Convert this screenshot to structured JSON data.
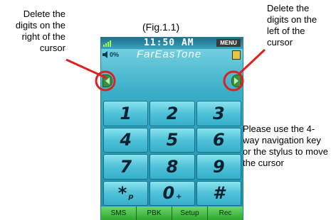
{
  "figure": {
    "caption": "(Fig.1.1)"
  },
  "annotations": {
    "left": "Delete the digits on the right of the cursor",
    "right": "Delete the digits on the left of the cursor",
    "bottom": "Please use the 4-way navigation key or the stylus to move the cursor"
  },
  "phone": {
    "status": {
      "time": "11:50 AM",
      "menu_label": "MENU",
      "volume_level": "0%"
    },
    "carrier": "FarEasTone",
    "keys": [
      {
        "label": "1",
        "sub": ""
      },
      {
        "label": "2",
        "sub": ""
      },
      {
        "label": "3",
        "sub": ""
      },
      {
        "label": "4",
        "sub": ""
      },
      {
        "label": "5",
        "sub": ""
      },
      {
        "label": "6",
        "sub": ""
      },
      {
        "label": "7",
        "sub": ""
      },
      {
        "label": "8",
        "sub": ""
      },
      {
        "label": "9",
        "sub": ""
      },
      {
        "label": "*",
        "sub": "p"
      },
      {
        "label": "0",
        "sub": "+"
      },
      {
        "label": "#",
        "sub": ""
      }
    ],
    "softkeys": [
      "SMS",
      "PBK",
      "Setup",
      "Rec"
    ]
  },
  "colors": {
    "highlight": "#e02020",
    "screen": "#3aaec7",
    "softkey_bar": "#2ea82e"
  }
}
